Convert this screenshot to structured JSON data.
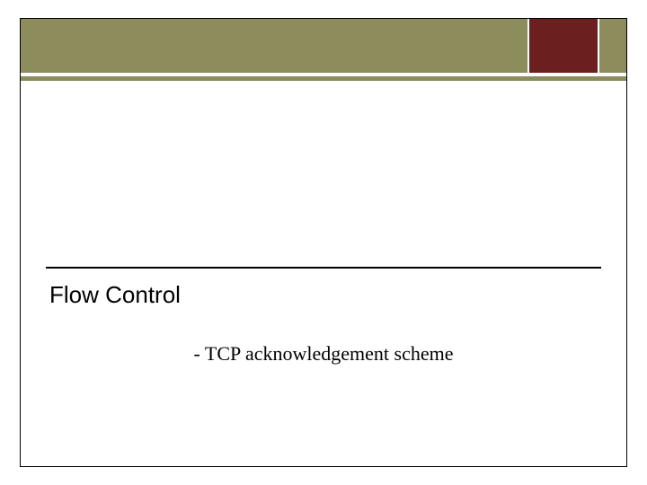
{
  "slide": {
    "title": "Flow Control",
    "subtitle": "- TCP acknowledgement scheme"
  },
  "colors": {
    "olive": "#8c8c5c",
    "maroon": "#6b1f1f"
  }
}
